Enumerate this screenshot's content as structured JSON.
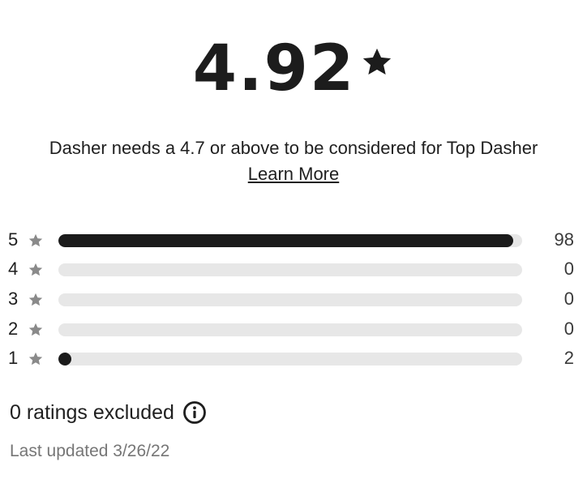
{
  "rating": {
    "value": "4.92",
    "icon": "star-icon"
  },
  "requirement_text": "Dasher needs a 4.7 or above to be considered for Top Dasher",
  "learn_more_label": "Learn More",
  "breakdown": [
    {
      "stars": "5",
      "count": "98",
      "fraction": 0.98
    },
    {
      "stars": "4",
      "count": "0",
      "fraction": 0
    },
    {
      "stars": "3",
      "count": "0",
      "fraction": 0
    },
    {
      "stars": "2",
      "count": "0",
      "fraction": 0
    },
    {
      "stars": "1",
      "count": "2",
      "fraction": 0.02
    }
  ],
  "excluded_text": "0 ratings excluded",
  "excluded_icon": "info-icon",
  "last_updated": "Last updated 3/26/22",
  "colors": {
    "bar_fill": "#1b1b1b",
    "bar_track": "#e7e7e7",
    "star_small": "#8a8a8a"
  }
}
